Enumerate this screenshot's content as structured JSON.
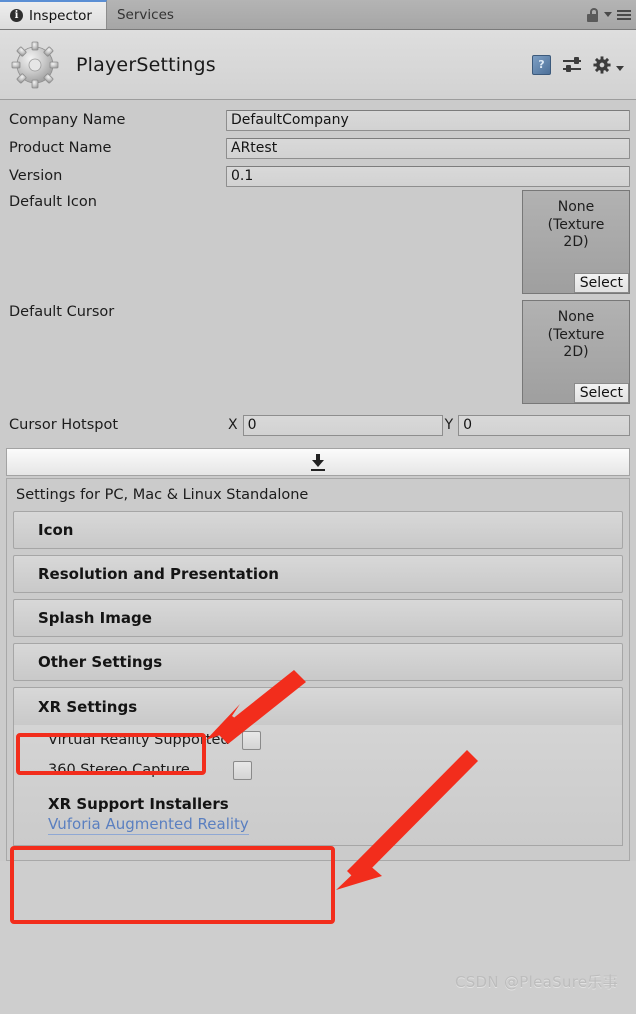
{
  "window": {
    "tabs": [
      {
        "label": "Inspector",
        "icon": "info-icon",
        "active": true
      },
      {
        "label": "Services",
        "icon": "",
        "active": false
      }
    ],
    "tabbar_icons": [
      "lock-icon",
      "chevron-down-icon",
      "hamburger-menu-icon"
    ]
  },
  "header": {
    "title": "PlayerSettings",
    "icon": "gear-icon",
    "actions": [
      "help-book-icon",
      "preset-icon",
      "settings-gear-icon"
    ]
  },
  "fields": {
    "company_name": {
      "label": "Company Name",
      "value": "DefaultCompany"
    },
    "product_name": {
      "label": "Product Name",
      "value": "ARtest"
    },
    "version": {
      "label": "Version",
      "value": "0.1"
    },
    "default_icon": {
      "label": "Default Icon",
      "value": "None\n(Texture 2D)",
      "button": "Select"
    },
    "default_cursor": {
      "label": "Default Cursor",
      "value": "None\n(Texture 2D)",
      "button": "Select"
    },
    "cursor_hotspot": {
      "label": "Cursor Hotspot",
      "x_label": "X",
      "x_value": "0",
      "y_label": "Y",
      "y_value": "0"
    }
  },
  "platform": {
    "install_icon": "download-arrow-icon",
    "settings_title": "Settings for PC, Mac & Linux Standalone",
    "sections": [
      {
        "label": "Icon"
      },
      {
        "label": "Resolution and Presentation"
      },
      {
        "label": "Splash Image"
      },
      {
        "label": "Other Settings"
      }
    ],
    "xr": {
      "label": "XR Settings",
      "options": [
        {
          "label": "Virtual Reality Supported",
          "checked": false
        },
        {
          "label": "360 Stereo Capture",
          "checked": false
        }
      ],
      "installers_title": "XR Support Installers",
      "installer_link": "Vuforia Augmented Reality"
    }
  },
  "annotations": {
    "highlight_color": "#f22d1c",
    "arrow_color": "#f22d1c",
    "boxes": [
      "xr-settings-highlight",
      "xr-support-installers-highlight"
    ],
    "arrows": [
      "arrow-to-xr-settings",
      "arrow-to-xr-installers"
    ]
  },
  "watermark": {
    "text": "CSDN @PleaSure乐事"
  }
}
